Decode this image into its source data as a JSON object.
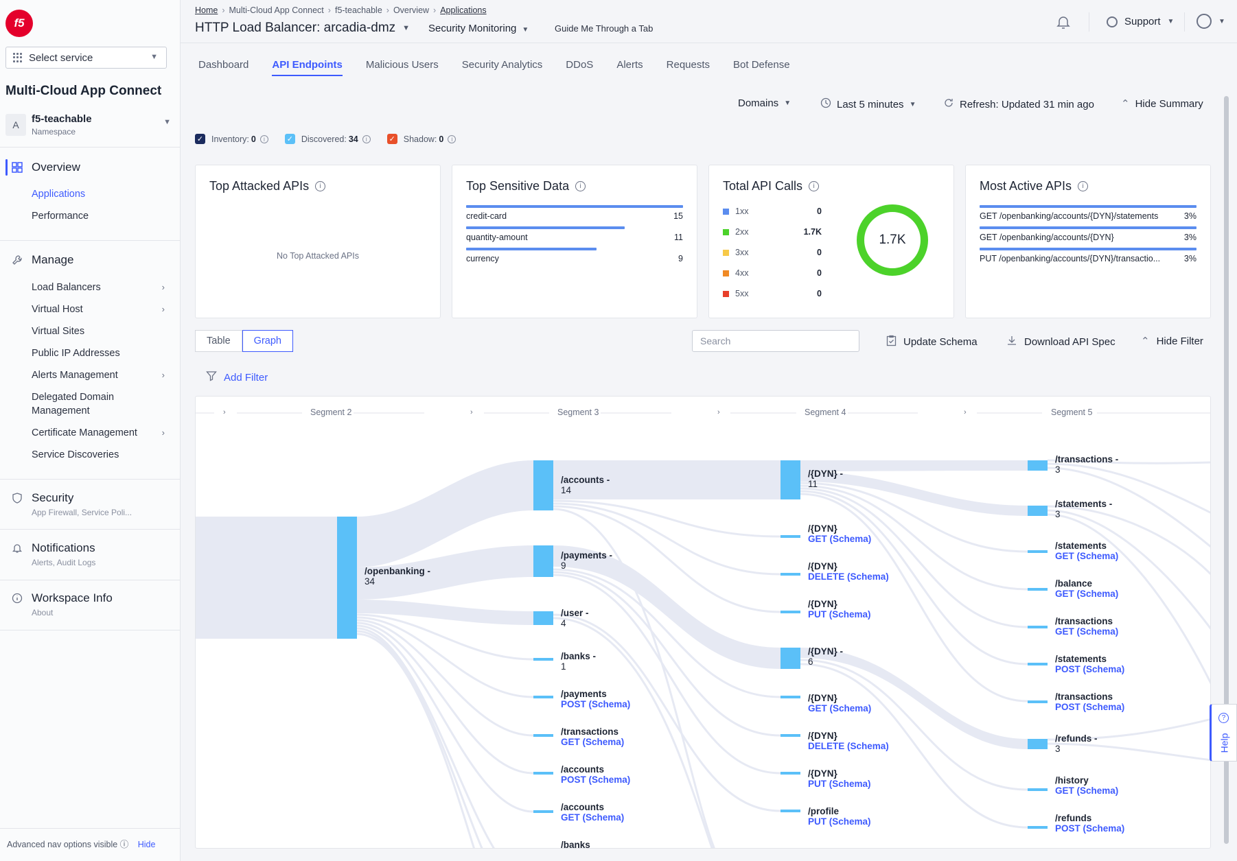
{
  "sidebar": {
    "logo": "f5",
    "service_select": "Select service",
    "app_title": "Multi-Cloud App Connect",
    "namespace": {
      "avatar": "A",
      "name": "f5-teachable",
      "label": "Namespace"
    },
    "overview": {
      "label": "Overview",
      "items": [
        "Applications",
        "Performance"
      ]
    },
    "manage": {
      "label": "Manage",
      "items": [
        "Load Balancers",
        "Virtual Host",
        "Virtual Sites",
        "Public IP Addresses",
        "Alerts Management",
        "Delegated Domain Management",
        "Certificate Management",
        "Service Discoveries"
      ]
    },
    "security": {
      "label": "Security",
      "desc": "App Firewall, Service Poli..."
    },
    "notifications": {
      "label": "Notifications",
      "desc": "Alerts, Audit Logs"
    },
    "workspace": {
      "label": "Workspace Info",
      "desc": "About"
    },
    "advanced": {
      "text": "Advanced nav options visible",
      "hide": "Hide"
    }
  },
  "header": {
    "breadcrumbs": [
      "Home",
      "Multi-Cloud App Connect",
      "f5-teachable",
      "Overview",
      "Applications"
    ],
    "title": "HTTP Load Balancer: arcadia-dmz",
    "mode": "Security Monitoring",
    "guide": "Guide Me Through a Tab",
    "support": "Support"
  },
  "tabs": [
    "Dashboard",
    "API Endpoints",
    "Malicious Users",
    "Security Analytics",
    "DDoS",
    "Alerts",
    "Requests",
    "Bot Defense"
  ],
  "controls": {
    "domains": "Domains",
    "time": "Last 5 minutes",
    "refresh": "Refresh: Updated 31 min ago",
    "hide_summary": "Hide Summary"
  },
  "checks": [
    {
      "label": "Inventory:",
      "value": "0",
      "color": "#1b2b5e"
    },
    {
      "label": "Discovered:",
      "value": "34",
      "color": "#5bc0f8"
    },
    {
      "label": "Shadow:",
      "value": "0",
      "color": "#e8502a"
    }
  ],
  "cards": {
    "attacked": {
      "title": "Top Attacked APIs",
      "empty": "No Top Attacked APIs"
    },
    "sensitive": {
      "title": "Top Sensitive Data",
      "rows": [
        {
          "label": "credit-card",
          "value": "15",
          "fraction": 1.0
        },
        {
          "label": "quantity-amount",
          "value": "11",
          "fraction": 0.73
        },
        {
          "label": "currency",
          "value": "9",
          "fraction": 0.6
        }
      ]
    },
    "calls": {
      "title": "Total API Calls",
      "total": "1.7K",
      "legend": [
        {
          "label": "1xx",
          "value": "0",
          "color": "#5b8def"
        },
        {
          "label": "2xx",
          "value": "1.7K",
          "color": "#4cd22a"
        },
        {
          "label": "3xx",
          "value": "0",
          "color": "#f7c948"
        },
        {
          "label": "4xx",
          "value": "0",
          "color": "#f08a24"
        },
        {
          "label": "5xx",
          "value": "0",
          "color": "#e8402a"
        }
      ]
    },
    "active": {
      "title": "Most Active APIs",
      "rows": [
        {
          "label": "GET /openbanking/accounts/{DYN}/statements",
          "value": "3%"
        },
        {
          "label": "GET /openbanking/accounts/{DYN}",
          "value": "3%"
        },
        {
          "label": "PUT /openbanking/accounts/{DYN}/transactio...",
          "value": "3%"
        }
      ]
    }
  },
  "view": {
    "table": "Table",
    "graph": "Graph",
    "search_placeholder": "Search",
    "update_schema": "Update Schema",
    "download_spec": "Download API Spec",
    "hide_filter": "Hide Filter",
    "add_filter": "Add Filter"
  },
  "graph": {
    "segments": [
      "Segment 2",
      "Segment 3",
      "Segment 4",
      "Segment 5"
    ],
    "seg2": [
      {
        "name": "/openbanking -",
        "count": "34"
      }
    ],
    "seg3": [
      {
        "name": "/accounts -",
        "count": "14"
      },
      {
        "name": "/payments -",
        "count": "9"
      },
      {
        "name": "/user -",
        "count": "4"
      },
      {
        "name": "/banks -",
        "count": "1"
      },
      {
        "name": "/payments",
        "method": "POST (Schema)"
      },
      {
        "name": "/transactions",
        "method": "GET (Schema)"
      },
      {
        "name": "/accounts",
        "method": "POST (Schema)"
      },
      {
        "name": "/accounts",
        "method": "GET (Schema)"
      },
      {
        "name": "/banks",
        "method": ""
      }
    ],
    "seg4": [
      {
        "name": "/{DYN} -",
        "count": "11"
      },
      {
        "name": "/{DYN}",
        "method": "GET (Schema)"
      },
      {
        "name": "/{DYN}",
        "method": "DELETE (Schema)"
      },
      {
        "name": "/{DYN}",
        "method": "PUT (Schema)"
      },
      {
        "name": "/{DYN} -",
        "count": "6"
      },
      {
        "name": "/{DYN}",
        "method": "GET (Schema)"
      },
      {
        "name": "/{DYN}",
        "method": "DELETE (Schema)"
      },
      {
        "name": "/{DYN}",
        "method": "PUT (Schema)"
      },
      {
        "name": "/profile",
        "method": "PUT (Schema)"
      }
    ],
    "seg5": [
      {
        "name": "/transactions -",
        "count": "3"
      },
      {
        "name": "/statements -",
        "count": "3"
      },
      {
        "name": "/statements",
        "method": "GET (Schema)"
      },
      {
        "name": "/balance",
        "method": "GET (Schema)"
      },
      {
        "name": "/transactions",
        "method": "GET (Schema)"
      },
      {
        "name": "/statements",
        "method": "POST (Schema)"
      },
      {
        "name": "/transactions",
        "method": "POST (Schema)"
      },
      {
        "name": "/refunds -",
        "count": "3"
      },
      {
        "name": "/history",
        "method": "GET (Schema)"
      },
      {
        "name": "/refunds",
        "method": "POST (Schema)"
      }
    ]
  },
  "help": "Help"
}
